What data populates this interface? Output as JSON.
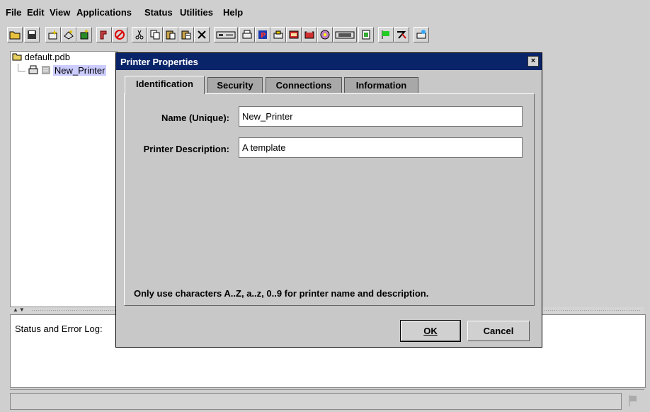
{
  "menu": {
    "file": "File",
    "edit": "Edit",
    "view": "View",
    "applications": "Applications",
    "status": "Status",
    "utilities": "Utilities",
    "help": "Help"
  },
  "toolbar": {
    "icons": [
      "open-folder-icon",
      "save-icon",
      "new-printer-icon",
      "new-queue-icon",
      "new-document-icon",
      "pipe-icon",
      "stop-icon",
      "cut-icon",
      "copy-icon",
      "paste-icon",
      "paste-special-icon",
      "delete-icon",
      "device-icon",
      "printer-icon",
      "red-doc-icon",
      "yellow-printer-icon",
      "red-box-icon",
      "queue-icon",
      "color-printer-icon",
      "monitor-icon",
      "green-doc-icon",
      "green-flag-icon",
      "tools-icon",
      "spray-printer-icon"
    ]
  },
  "tree": {
    "root": "default.pdb",
    "child": "New_Printer"
  },
  "log": {
    "label": "Status and Error Log:"
  },
  "dialog": {
    "title": "Printer Properties",
    "close": "×",
    "tabs": [
      "Identification",
      "Security",
      "Connections",
      "Information"
    ],
    "name_label": "Name (Unique):",
    "name_value": "New_Printer",
    "desc_label": "Printer Description:",
    "desc_value": "A template",
    "hint": "Only use characters A..Z, a..z, 0..9 for printer name and description.",
    "ok_label": "OK",
    "cancel_label": "Cancel"
  }
}
